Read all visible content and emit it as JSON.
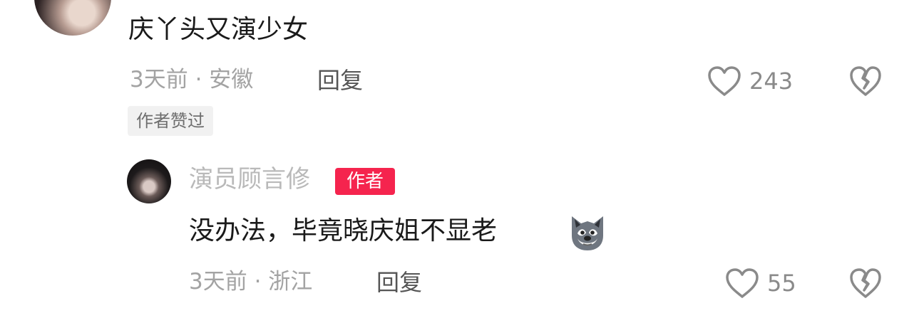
{
  "comment": {
    "text": "庆丫头又演少女",
    "time_location": "3天前 · 安徽",
    "reply_label": "回复",
    "like_count": "243",
    "author_liked_badge": "作者赞过"
  },
  "reply": {
    "username": "演员顾言修",
    "author_badge": "作者",
    "text": "没办法，毕竟晓庆姐不显老",
    "emoji": "wolf-face-emoji",
    "time_location": "3天前 · 浙江",
    "reply_label": "回复",
    "like_count": "55"
  },
  "icons": {
    "like": "heart-outline-icon",
    "dislike": "broken-heart-icon"
  },
  "colors": {
    "author_badge_bg": "#f5244e",
    "meta_text": "#a3a3a3",
    "reply_label": "#555555"
  }
}
